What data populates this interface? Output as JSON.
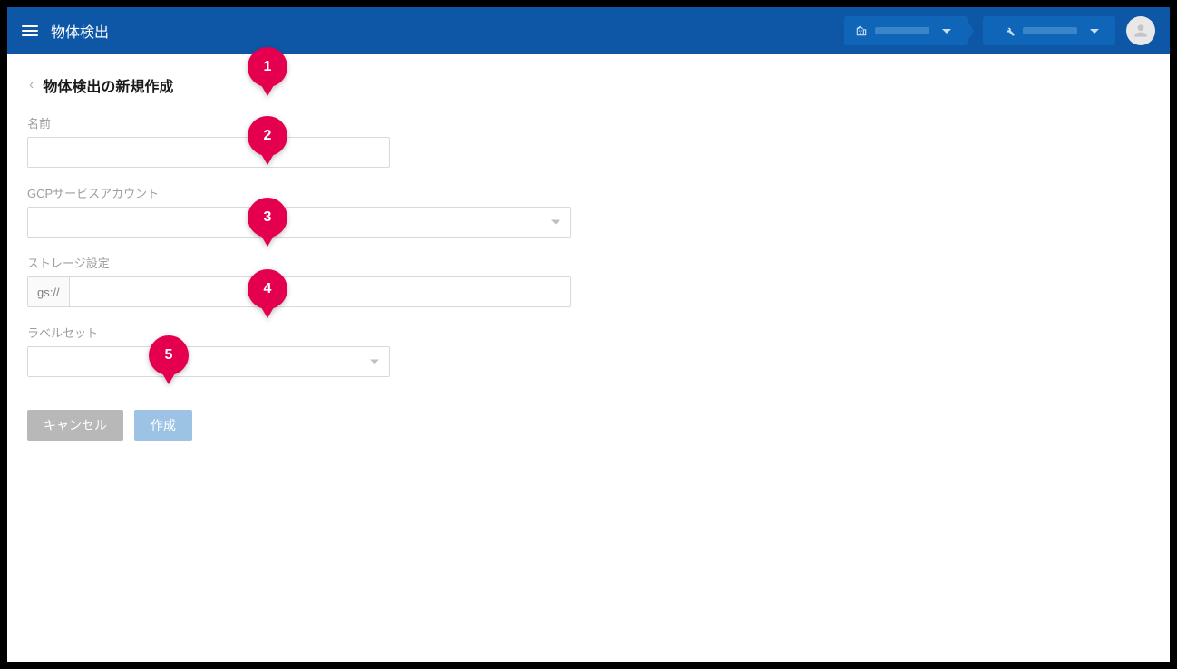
{
  "header": {
    "app_title": "物体検出"
  },
  "page": {
    "title": "物体検出の新規作成"
  },
  "form": {
    "name": {
      "label": "名前",
      "value": ""
    },
    "gcp_service_account": {
      "label": "GCPサービスアカウント",
      "value": ""
    },
    "storage": {
      "label": "ストレージ設定",
      "prefix": "gs://",
      "value": ""
    },
    "label_set": {
      "label": "ラベルセット",
      "value": ""
    }
  },
  "buttons": {
    "cancel": "キャンセル",
    "submit": "作成"
  },
  "markers": [
    {
      "n": "1"
    },
    {
      "n": "2"
    },
    {
      "n": "3"
    },
    {
      "n": "4"
    },
    {
      "n": "5"
    }
  ]
}
